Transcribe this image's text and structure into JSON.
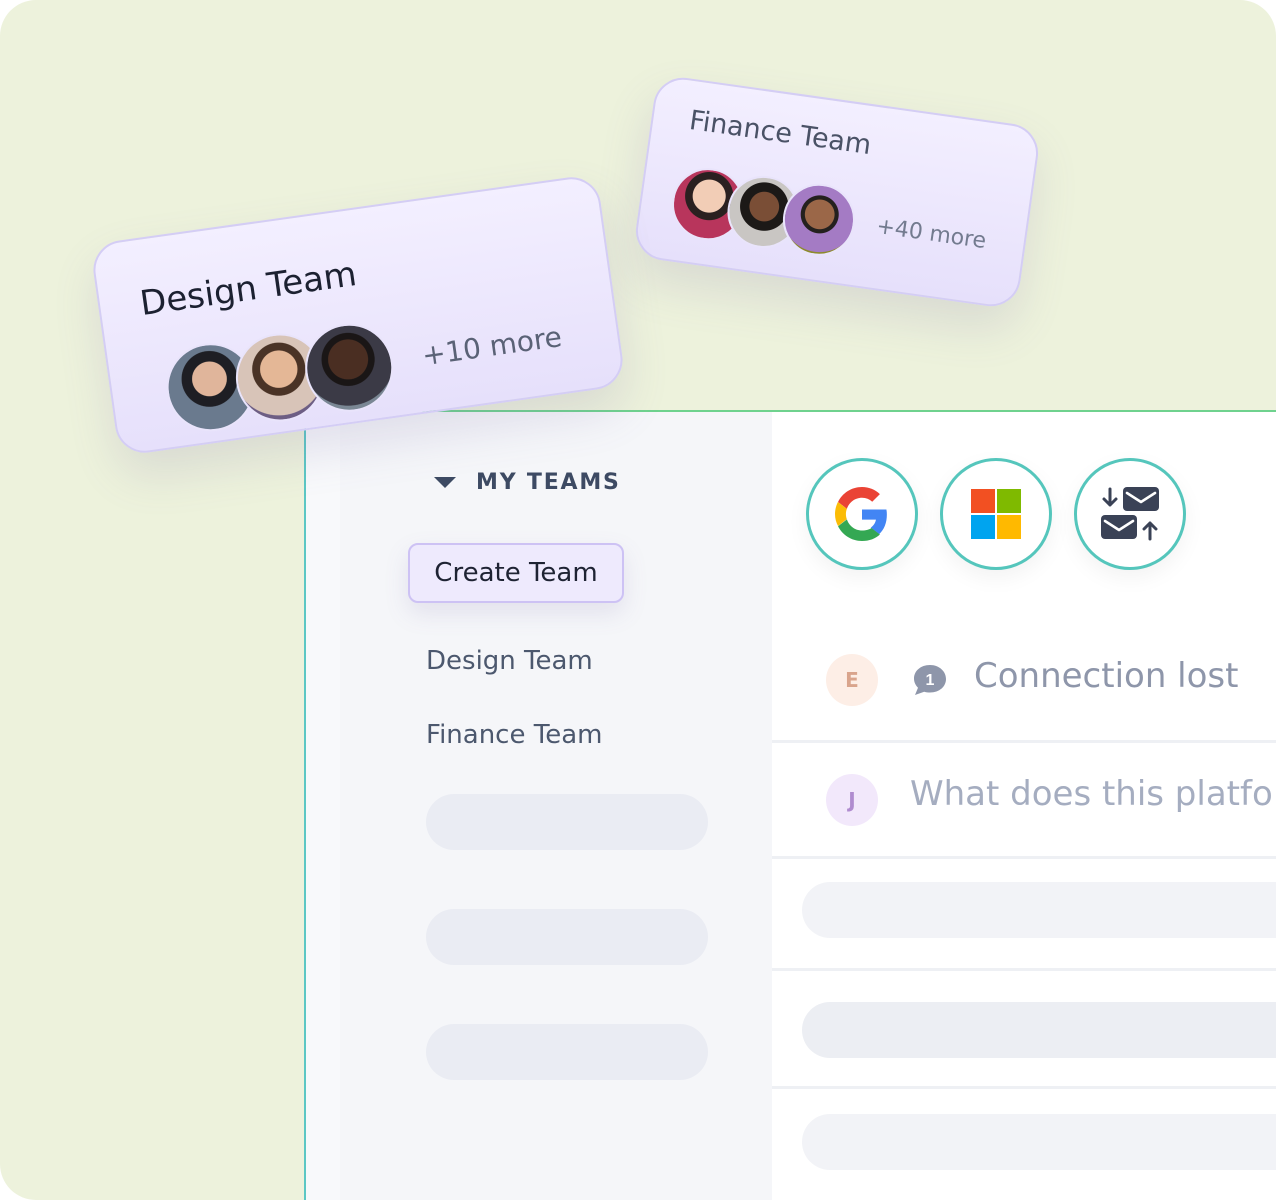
{
  "sidebar": {
    "section_label": "MY TEAMS",
    "create_button": "Create Team",
    "teams": [
      "Design Team",
      "Finance Team"
    ]
  },
  "providers": [
    {
      "name": "google-icon"
    },
    {
      "name": "microsoft-icon"
    },
    {
      "name": "mail-sync-icon"
    }
  ],
  "messages": [
    {
      "initial": "E",
      "text": "Connection lost",
      "badge": "1",
      "avatar_bg": "#fdeee6",
      "avatar_fg": "#d9a48c"
    },
    {
      "initial": "J",
      "text": "What does this platfo",
      "avatar_bg": "#f2e8fb",
      "avatar_fg": "#b08ccf"
    }
  ],
  "cards": {
    "design": {
      "title": "Design Team",
      "more": "+10 more"
    },
    "finance": {
      "title": "Finance Team",
      "more": "+40 more"
    }
  },
  "colors": {
    "accent": "#55c6bc",
    "background": "#edf2dc",
    "card": "#efeafd"
  }
}
